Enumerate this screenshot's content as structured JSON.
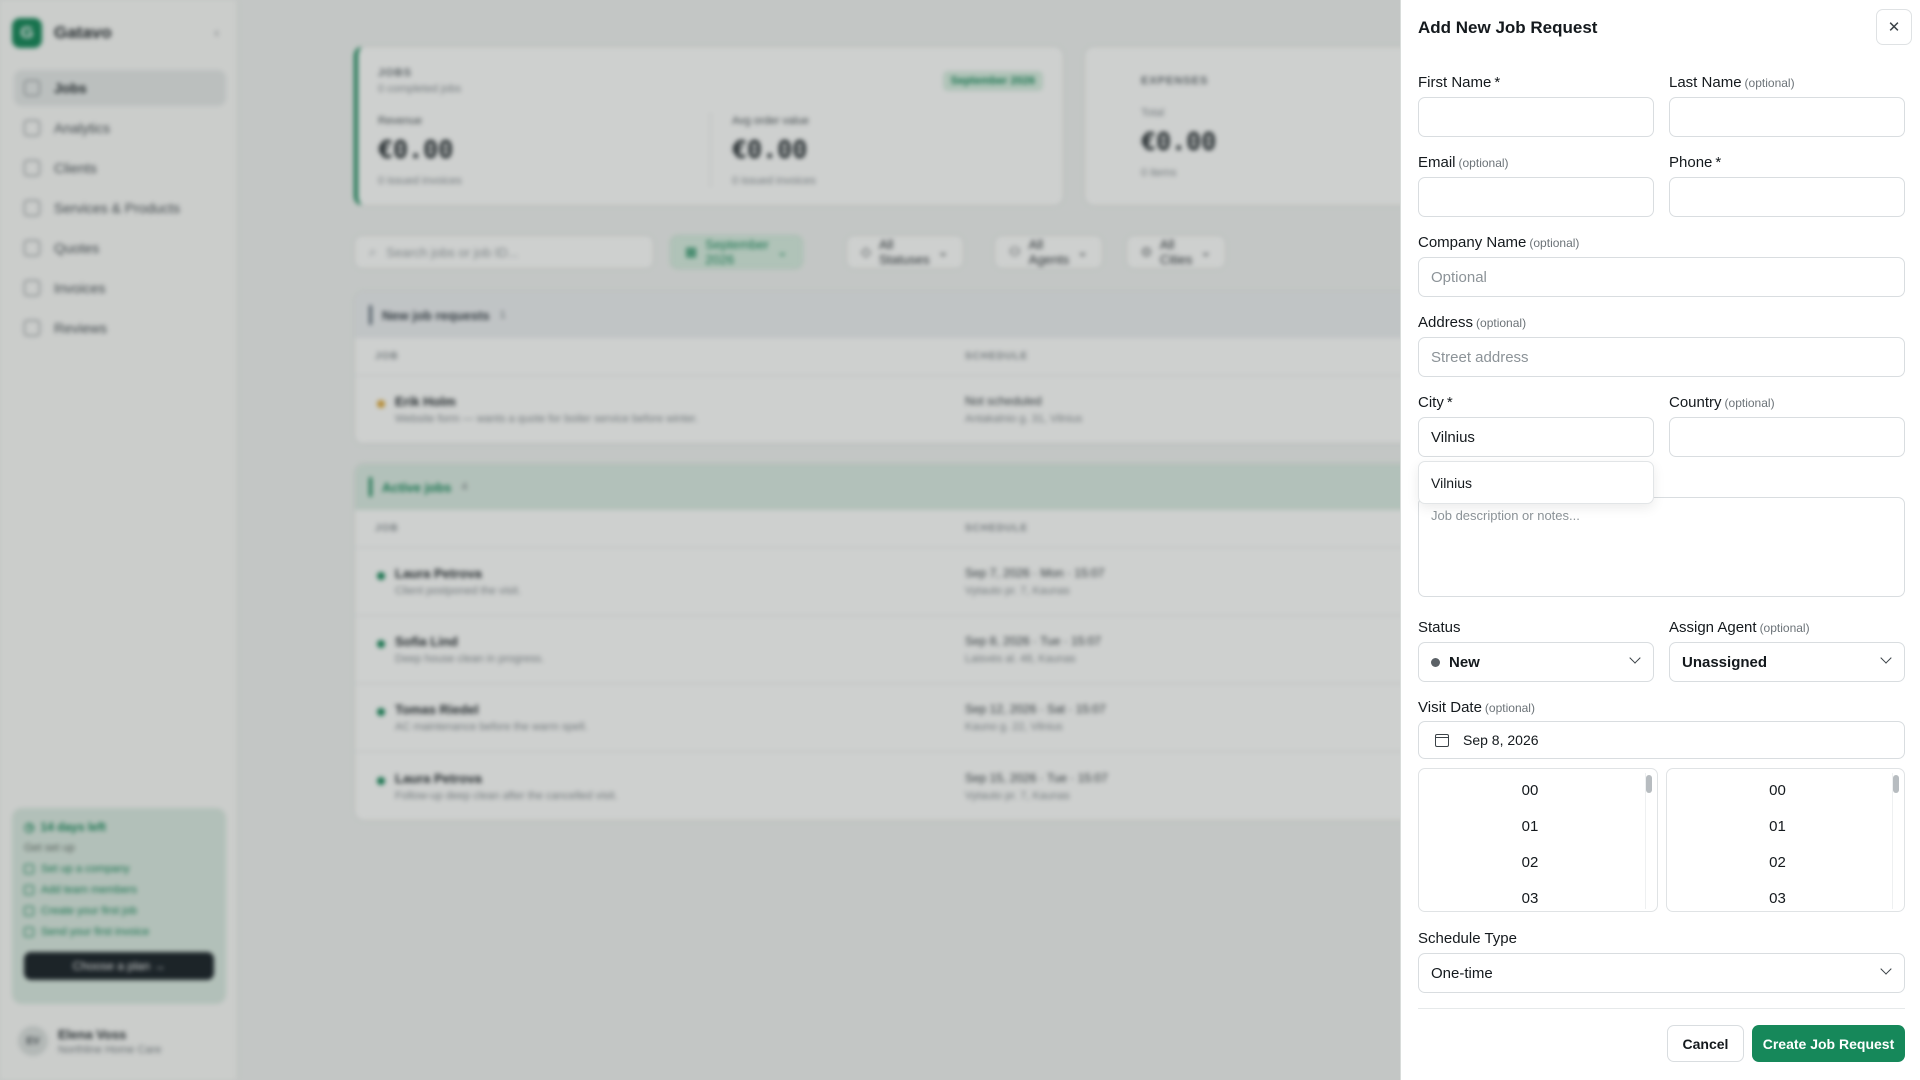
{
  "app": {
    "brand_initial": "G",
    "brand_name": "Gatavo",
    "nav": [
      {
        "label": "Jobs",
        "icon": "grid-icon"
      },
      {
        "label": "Analytics",
        "icon": "bar-chart-icon"
      },
      {
        "label": "Clients",
        "icon": "users-icon"
      },
      {
        "label": "Services & Products",
        "icon": "box-icon"
      },
      {
        "label": "Quotes",
        "icon": "document-icon"
      },
      {
        "label": "Invoices",
        "icon": "invoice-icon"
      },
      {
        "label": "Reviews",
        "icon": "star-icon"
      }
    ],
    "trial": {
      "title": "14 days left",
      "subtitle": "Get set up",
      "steps": [
        "Set up a company",
        "Add team members",
        "Create your first job",
        "Send your first invoice"
      ],
      "cta": "Choose a plan →"
    },
    "user": {
      "initials": "EV",
      "name": "Elena Voss",
      "org": "Northline Home Care"
    }
  },
  "dashboard": {
    "jobs_card": {
      "label": "JOBS",
      "sub": "0 completed jobs",
      "badge": "September 2026",
      "revenue_label": "Revenue",
      "revenue_value": "€0.00",
      "revenue_sub": "0 issued invoices",
      "aov_label": "Avg order value",
      "aov_value": "€0.00",
      "aov_sub": "0 issued invoices"
    },
    "expenses_card": {
      "label": "EXPENSES",
      "total_label": "Total",
      "total_value": "€0.00",
      "total_sub": "0 items"
    },
    "filters": {
      "search_placeholder": "Search jobs or job ID...",
      "month": "September 2026",
      "statuses": "All Statuses",
      "agents": "All Agents",
      "cities": "All Cities"
    },
    "new_requests": {
      "title": "New job requests",
      "count": "1",
      "col_job": "JOB",
      "col_schedule": "SCHEDULE",
      "rows": [
        {
          "name": "Erik Holm",
          "desc": "Website form — wants a quote for boiler service before winter.",
          "date": "Not scheduled",
          "addr": "Antakalnio g. 31, Vilnius"
        }
      ]
    },
    "active_jobs": {
      "title": "Active jobs",
      "count": "4",
      "col_job": "JOB",
      "col_schedule": "SCHEDULE",
      "rows": [
        {
          "name": "Laura Petrova",
          "desc": "Client postponed the visit.",
          "date": "Sep 7, 2026 · Mon · 15:07",
          "addr": "Vytauto pr. 7, Kaunas"
        },
        {
          "name": "Sofia Lind",
          "desc": "Deep house clean in progress.",
          "date": "Sep 8, 2026 · Tue · 15:07",
          "addr": "Laisvės al. 48, Kaunas"
        },
        {
          "name": "Tomas Riedel",
          "desc": "AC maintenance before the warm spell.",
          "date": "Sep 12, 2026 · Sat · 15:07",
          "addr": "Kauno g. 22, Vilnius"
        },
        {
          "name": "Laura Petrova",
          "desc": "Follow-up deep clean after the cancelled visit.",
          "date": "Sep 15, 2026 · Tue · 15:07",
          "addr": "Vytauto pr. 7, Kaunas"
        }
      ]
    }
  },
  "drawer": {
    "title": "Add New Job Request",
    "close_symbol": "✕",
    "first_name": {
      "label": "First Name",
      "req": "*",
      "value": ""
    },
    "last_name": {
      "label": "Last Name",
      "opt": "(optional)",
      "value": ""
    },
    "email": {
      "label": "Email",
      "opt": "(optional)",
      "value": ""
    },
    "phone": {
      "label": "Phone",
      "req": "*",
      "value": ""
    },
    "company": {
      "label": "Company Name",
      "opt": "(optional)",
      "placeholder": "Optional"
    },
    "address": {
      "label": "Address",
      "opt": "(optional)",
      "placeholder": "Street address"
    },
    "city": {
      "label": "City",
      "req": "*",
      "value": "Vilnius",
      "suggestion": "Vilnius"
    },
    "country": {
      "label": "Country",
      "opt": "(optional)",
      "value": ""
    },
    "notes": {
      "placeholder": "Job description or notes..."
    },
    "status": {
      "label": "Status",
      "value": "New"
    },
    "agent": {
      "label": "Assign Agent",
      "opt": "(optional)",
      "value": "Unassigned"
    },
    "visit_date": {
      "label": "Visit Date",
      "opt": "(optional)",
      "value": "Sep 8, 2026"
    },
    "hours": [
      "00",
      "01",
      "02",
      "03"
    ],
    "minutes": [
      "00",
      "01",
      "02",
      "03"
    ],
    "schedule_type": {
      "label": "Schedule Type",
      "value": "One-time"
    },
    "cancel": "Cancel",
    "create": "Create Job Request"
  },
  "colors": {
    "accent": "#16885a",
    "overlay": "rgba(30,40,38,0.22)"
  }
}
